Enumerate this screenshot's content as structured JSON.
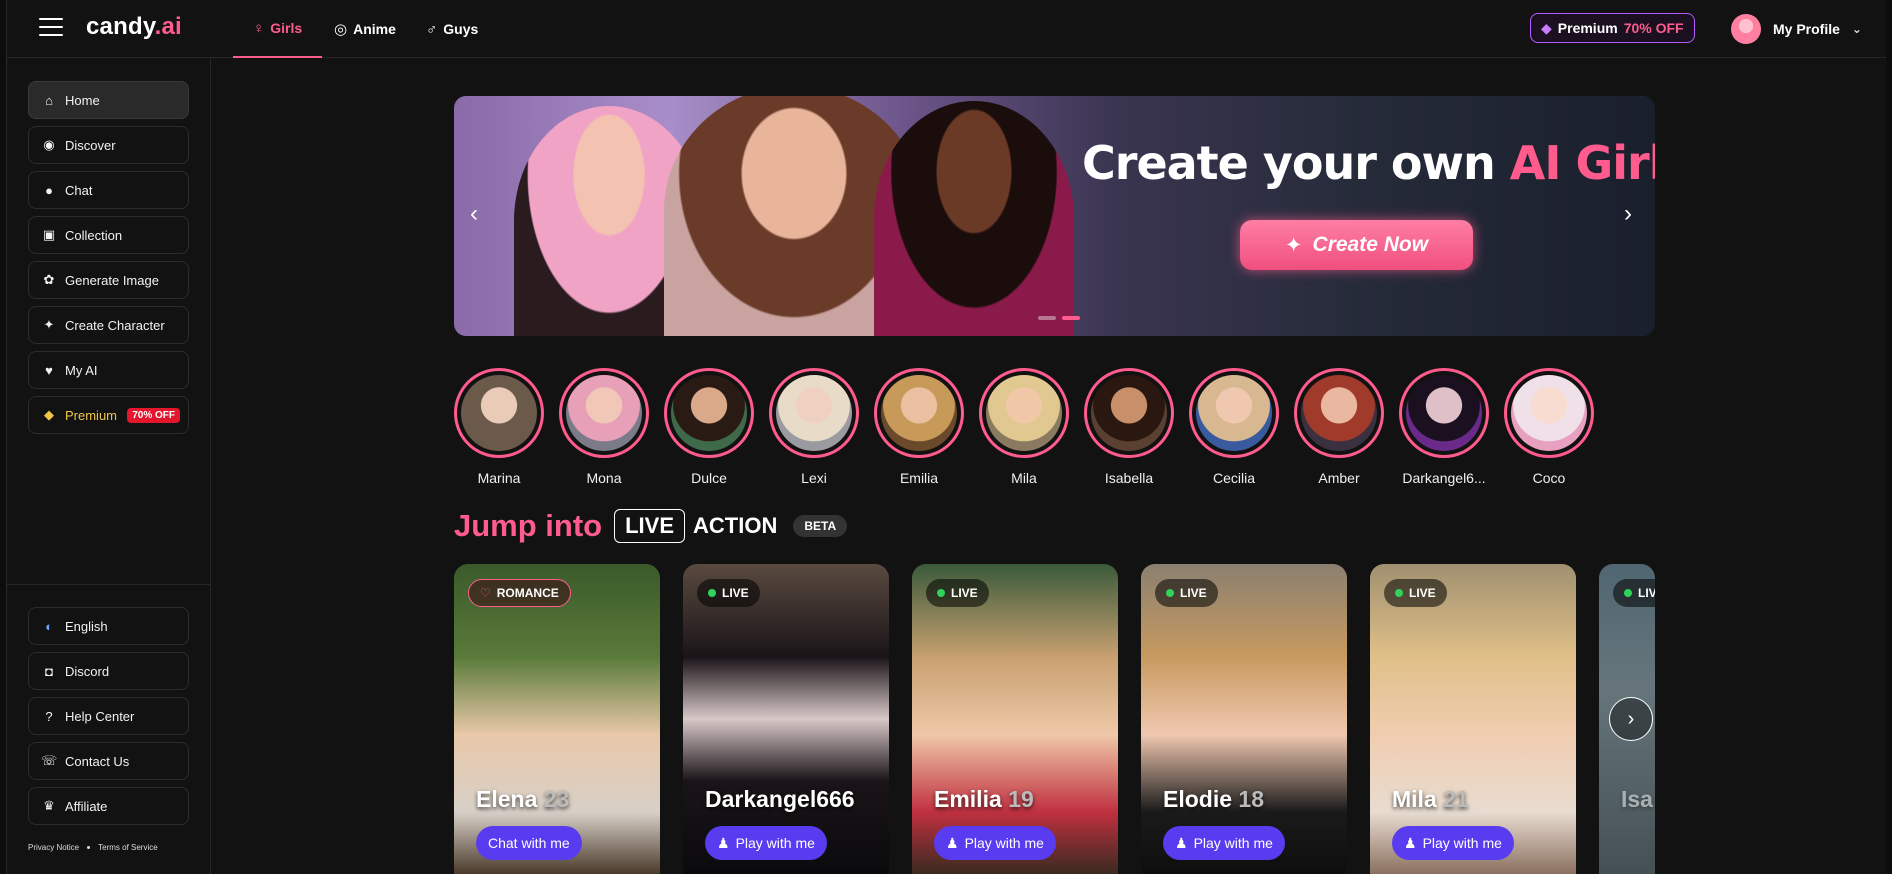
{
  "header": {
    "logo_text": "candy",
    "logo_accent": ".ai",
    "tabs": [
      {
        "label": "Girls",
        "icon": "female-icon"
      },
      {
        "label": "Anime",
        "icon": "anime-icon"
      },
      {
        "label": "Guys",
        "icon": "male-icon"
      }
    ],
    "premium_label": "Premium",
    "premium_off": "70% OFF",
    "profile_label": "My Profile"
  },
  "sidebar": {
    "items": [
      {
        "label": "Home",
        "icon": "home-icon"
      },
      {
        "label": "Discover",
        "icon": "compass-icon"
      },
      {
        "label": "Chat",
        "icon": "chat-icon"
      },
      {
        "label": "Collection",
        "icon": "gallery-icon"
      },
      {
        "label": "Generate Image",
        "icon": "image-gen-icon"
      },
      {
        "label": "Create Character",
        "icon": "magic-wand-icon"
      },
      {
        "label": "My AI",
        "icon": "heart-icon"
      },
      {
        "label": "Premium",
        "icon": "diamond-icon",
        "badge": "70% OFF"
      }
    ],
    "bottom_items": [
      {
        "label": "English",
        "icon": "us-flag-icon"
      },
      {
        "label": "Discord",
        "icon": "discord-icon"
      },
      {
        "label": "Help Center",
        "icon": "help-icon"
      },
      {
        "label": "Contact Us",
        "icon": "contact-icon"
      },
      {
        "label": "Affiliate",
        "icon": "trophy-icon"
      }
    ],
    "privacy": "Privacy Notice",
    "terms": "Terms of Service"
  },
  "banner": {
    "title_white": "Create your own",
    "title_pink": "AI Girlfriend",
    "cta": "Create Now"
  },
  "stories": [
    "Marina",
    "Mona",
    "Dulce",
    "Lexi",
    "Emilia",
    "Mila",
    "Isabella",
    "Cecilia",
    "Amber",
    "Darkangel6...",
    "Coco"
  ],
  "jump": {
    "title": "Jump into",
    "live": "LIVE",
    "action": "ACTION",
    "beta": "BETA"
  },
  "cards": [
    {
      "tag": "ROMANCE",
      "name": "Elena",
      "age": "23",
      "button": "Chat with me"
    },
    {
      "tag": "LIVE",
      "name": "Darkangel666",
      "age": "",
      "button": "Play with me"
    },
    {
      "tag": "LIVE",
      "name": "Emilia",
      "age": "19",
      "button": "Play with me"
    },
    {
      "tag": "LIVE",
      "name": "Elodie",
      "age": "18",
      "button": "Play with me"
    },
    {
      "tag": "LIVE",
      "name": "Mila",
      "age": "21",
      "button": "Play with me"
    },
    {
      "tag": "LIVE",
      "name": "Isa",
      "age": "",
      "button": ""
    }
  ],
  "colors": {
    "accent": "#ff5c8d",
    "button": "#5a3cf0",
    "live_dot": "#2fd25a"
  }
}
